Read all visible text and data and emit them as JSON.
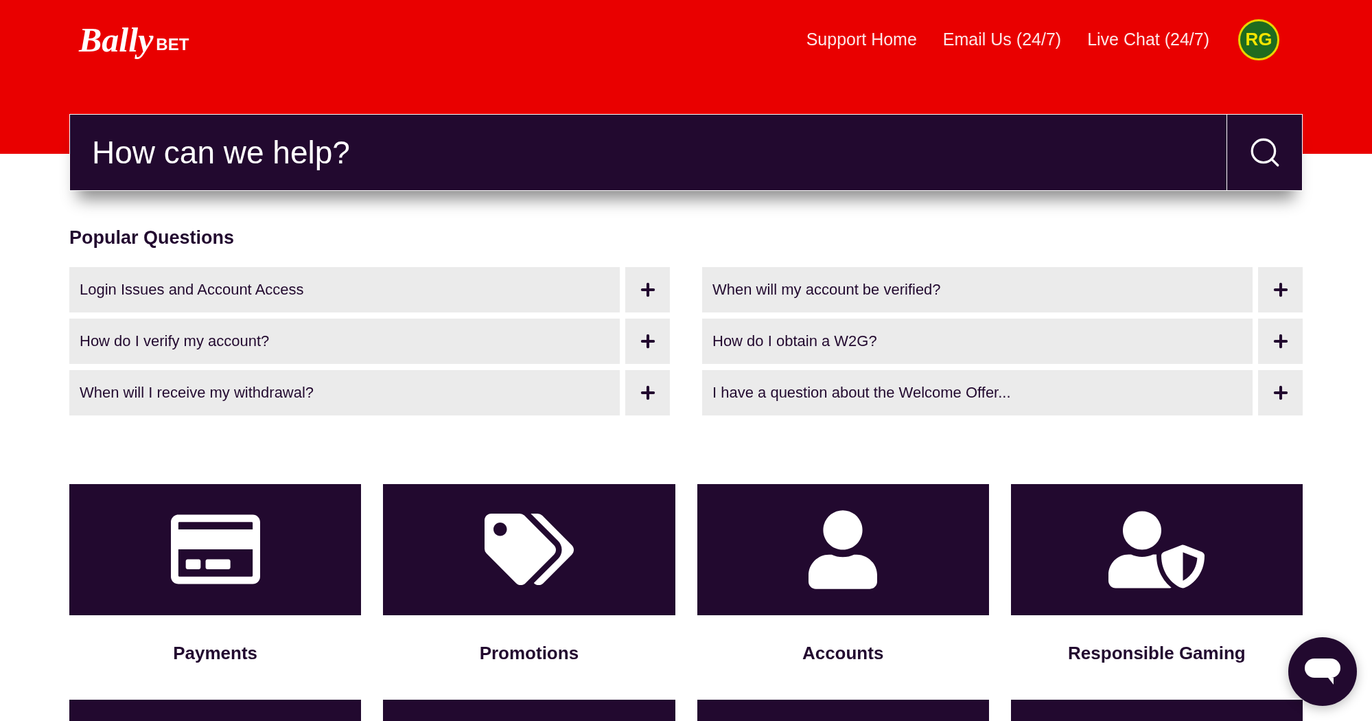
{
  "header": {
    "logo": {
      "script": "Bally",
      "word": "BET"
    },
    "nav": [
      "Support Home",
      "Email Us (24/7)",
      "Live Chat (24/7)"
    ],
    "badge": "RG"
  },
  "search": {
    "placeholder": "How can we help?"
  },
  "popular": {
    "title": "Popular Questions",
    "questions": [
      {
        "text": "Login Issues and Account Access",
        "expanded": false
      },
      {
        "text": "When will my account be verified?",
        "expanded": false
      },
      {
        "text": "How do I verify my account?",
        "expanded": false
      },
      {
        "text": "How do I obtain a W2G?",
        "expanded": false
      },
      {
        "text": "When will I receive my withdrawal?",
        "expanded": false
      },
      {
        "text": "I have a question about the Welcome Offer...",
        "expanded": false
      }
    ]
  },
  "categories": [
    {
      "label": "Payments",
      "kind": "card"
    },
    {
      "label": "Promotions",
      "kind": "tag"
    },
    {
      "label": "Accounts",
      "kind": "user"
    },
    {
      "label": "Responsible Gaming",
      "kind": "shield"
    }
  ]
}
